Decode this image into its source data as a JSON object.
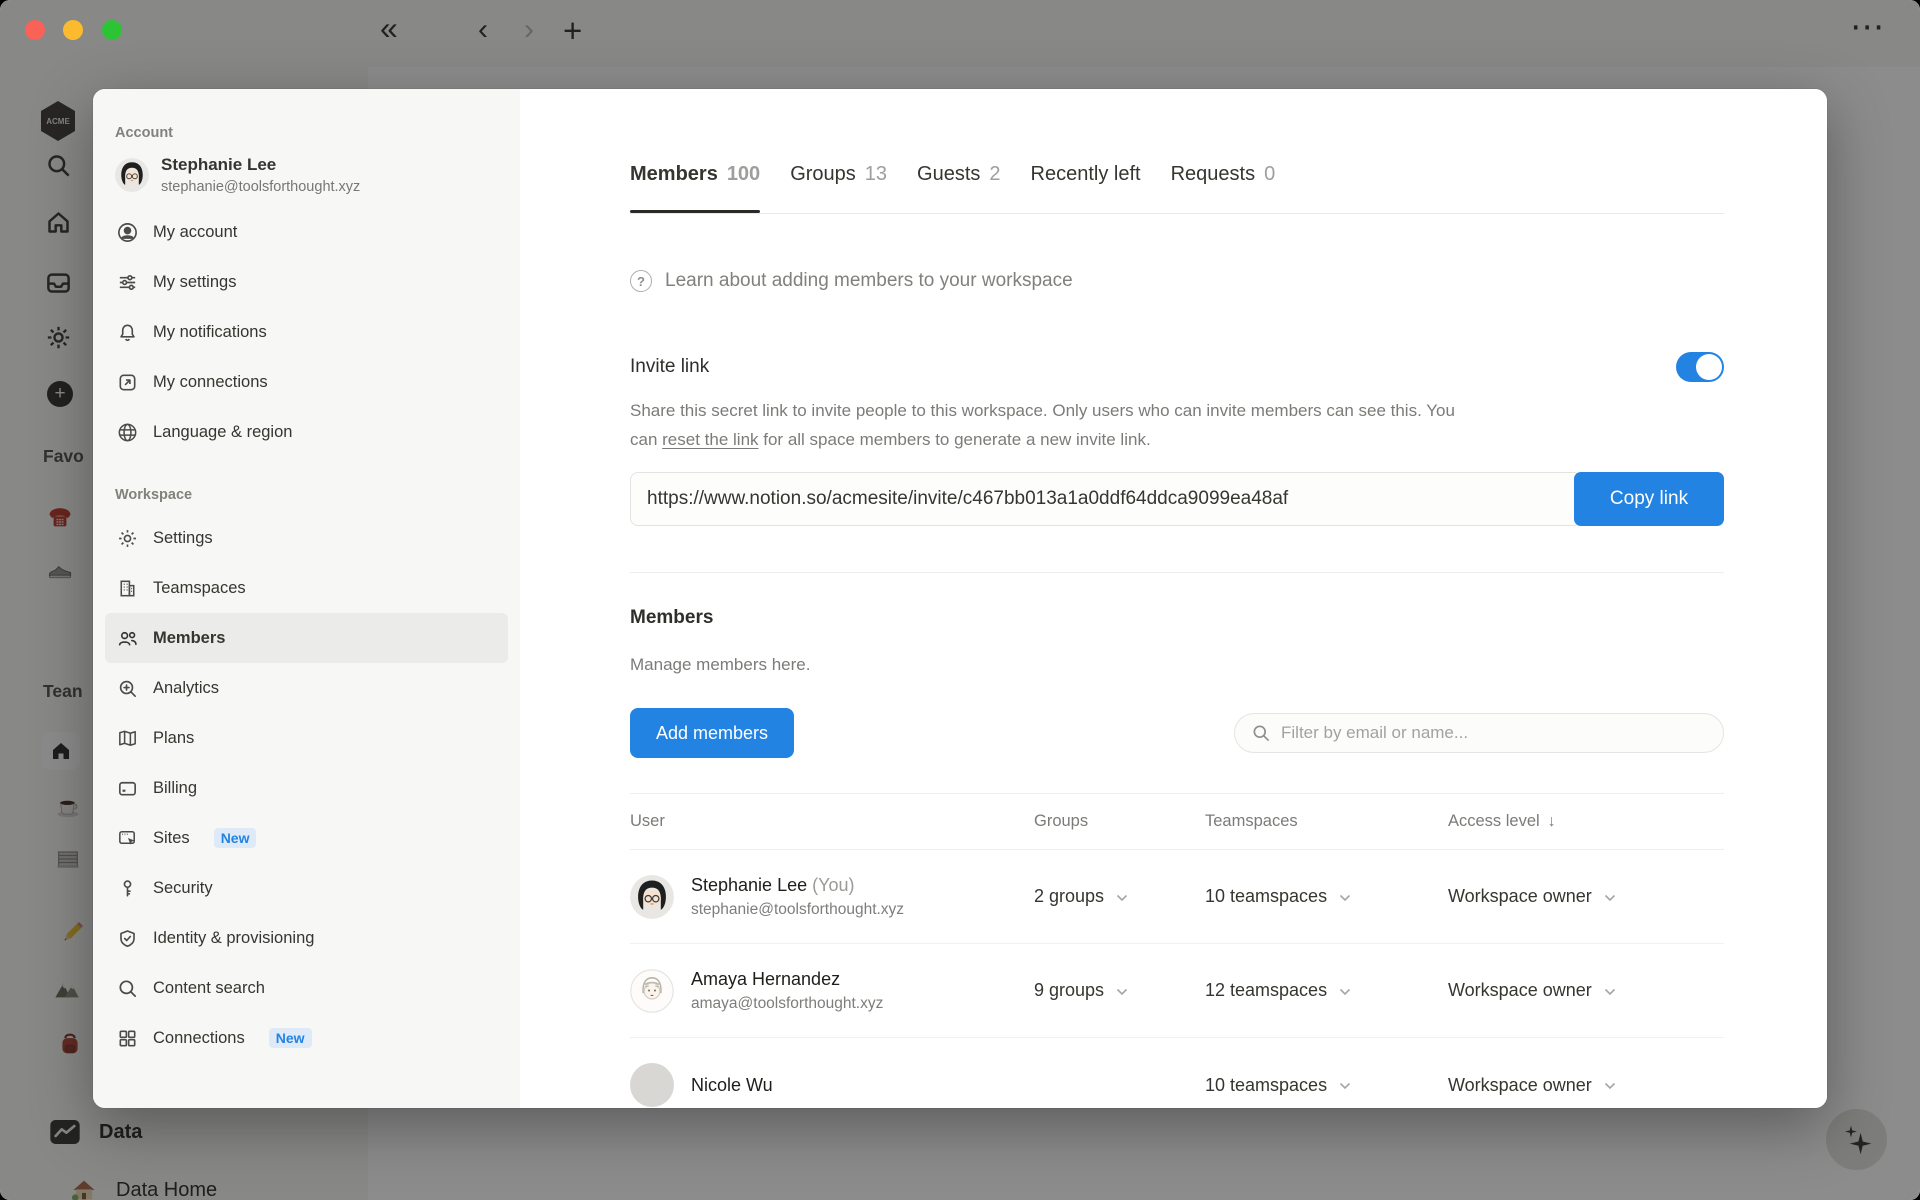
{
  "accent": "#2383e2",
  "titlebar": {
    "collapse_glyph": "«",
    "back_glyph": "‹",
    "forward_glyph": "›",
    "new_tab_glyph": "+",
    "more_glyph": "⋯"
  },
  "background": {
    "workspace_logo": "ACME",
    "favorites_label": "Favo",
    "teamspaces_label": "Tean",
    "data_item": "Data",
    "data_home_item": "Data Home"
  },
  "modal": {
    "account": {
      "title": "Account",
      "user": {
        "name": "Stephanie Lee",
        "email": "stephanie@toolsforthought.xyz"
      },
      "items": [
        "My account",
        "My settings",
        "My notifications",
        "My connections",
        "Language & region"
      ]
    },
    "workspace": {
      "title": "Workspace",
      "items": [
        {
          "label": "Settings",
          "badge": ""
        },
        {
          "label": "Teamspaces",
          "badge": ""
        },
        {
          "label": "Members",
          "badge": ""
        },
        {
          "label": "Analytics",
          "badge": ""
        },
        {
          "label": "Plans",
          "badge": ""
        },
        {
          "label": "Billing",
          "badge": ""
        },
        {
          "label": "Sites",
          "badge": "New"
        },
        {
          "label": "Security",
          "badge": ""
        },
        {
          "label": "Identity & provisioning",
          "badge": ""
        },
        {
          "label": "Content search",
          "badge": ""
        },
        {
          "label": "Connections",
          "badge": "New"
        }
      ]
    }
  },
  "content": {
    "tabs": [
      {
        "label": "Members",
        "count": "100"
      },
      {
        "label": "Groups",
        "count": "13"
      },
      {
        "label": "Guests",
        "count": "2"
      },
      {
        "label": "Recently left",
        "count": ""
      },
      {
        "label": "Requests",
        "count": "0"
      }
    ],
    "learn_link": "Learn about adding members to your workspace",
    "help_glyph": "?",
    "invite": {
      "title": "Invite link",
      "desc_before": "Share this secret link to invite people to this workspace. Only users who can invite members can see this. You can ",
      "desc_link": "reset the link",
      "desc_after": " for all space members to generate a new invite link.",
      "url": "https://www.notion.so/acmesite/invite/c467bb013a1a0ddf64ddca9099ea48af",
      "copy_label": "Copy link"
    },
    "members_section": {
      "title": "Members",
      "subtitle": "Manage members here.",
      "add_button": "Add members",
      "filter_placeholder": "Filter by email or name..."
    },
    "table": {
      "headers": {
        "user": "User",
        "groups": "Groups",
        "teamspaces": "Teamspaces",
        "access": "Access level"
      },
      "sort_arrow": "↓",
      "rows": [
        {
          "name": "Stephanie Lee",
          "you": "(You)",
          "email": "stephanie@toolsforthought.xyz",
          "groups": "2 groups",
          "teamspaces": "10 teamspaces",
          "access": "Workspace owner"
        },
        {
          "name": "Amaya Hernandez",
          "you": "",
          "email": "amaya@toolsforthought.xyz",
          "groups": "9 groups",
          "teamspaces": "12 teamspaces",
          "access": "Workspace owner"
        },
        {
          "name": "Nicole Wu",
          "you": "",
          "email": "",
          "groups": "",
          "teamspaces": "10 teamspaces",
          "access": "Workspace owner"
        }
      ]
    }
  }
}
